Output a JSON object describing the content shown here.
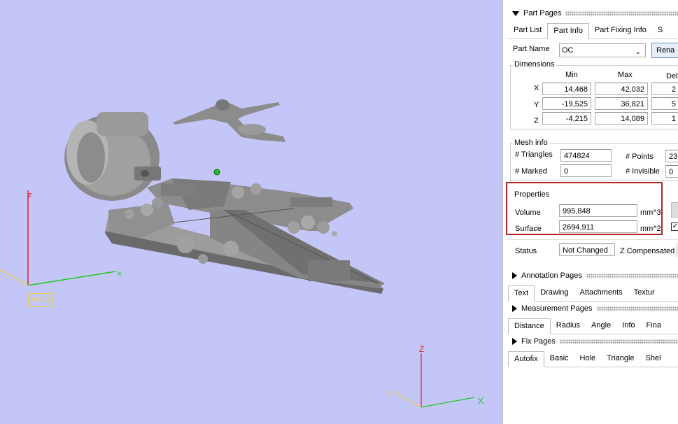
{
  "viewport": {
    "wcs_label": "WCS",
    "main_axes": {
      "x": "x",
      "z": "z"
    },
    "corner_axes": {
      "x": "X",
      "y": "Y",
      "z": "Z"
    }
  },
  "part_pages": {
    "header": "Part Pages",
    "tabs": [
      "Part List",
      "Part Info",
      "Part Fixing Info",
      "S"
    ],
    "active_tab": "Part Info",
    "part_name_label": "Part Name",
    "part_name_value": "OC",
    "rename_button": "Rena",
    "dimensions": {
      "title": "Dimensions",
      "columns": [
        "Min",
        "Max",
        "Delt"
      ],
      "rows": [
        {
          "axis": "X",
          "min": "14,468",
          "max": "42,032",
          "delta": "2"
        },
        {
          "axis": "Y",
          "min": "-19,525",
          "max": "36,821",
          "delta": "5"
        },
        {
          "axis": "Z",
          "min": "-4,215",
          "max": "14,089",
          "delta": "1"
        }
      ]
    },
    "mesh_info": {
      "title": "Mesh info",
      "triangles_label": "# Triangles",
      "triangles_value": "474824",
      "points_label": "# Points",
      "points_value": "23",
      "marked_label": "# Marked",
      "marked_value": "0",
      "invisible_label": "# Invisible",
      "invisible_value": "0"
    },
    "properties": {
      "title": "Properties",
      "volume_label": "Volume",
      "volume_value": "995,848",
      "volume_unit": "mm^3",
      "surface_label": "Surface",
      "surface_value": "2694,911",
      "surface_unit": "mm^2"
    },
    "status_label": "Status",
    "status_value": "Not Changed",
    "z_compensated_label": "Z Compensated"
  },
  "annotation_pages": {
    "header": "Annotation Pages",
    "tabs": [
      "Text",
      "Drawing",
      "Attachments",
      "Textur"
    ],
    "active_tab": "Text"
  },
  "measurement_pages": {
    "header": "Measurement Pages",
    "tabs": [
      "Distance",
      "Radius",
      "Angle",
      "Info",
      "Fina"
    ],
    "active_tab": "Distance"
  },
  "fix_pages": {
    "header": "Fix Pages",
    "tabs": [
      "Autofix",
      "Basic",
      "Hole",
      "Triangle",
      "Shel"
    ],
    "active_tab": "Autofix"
  }
}
